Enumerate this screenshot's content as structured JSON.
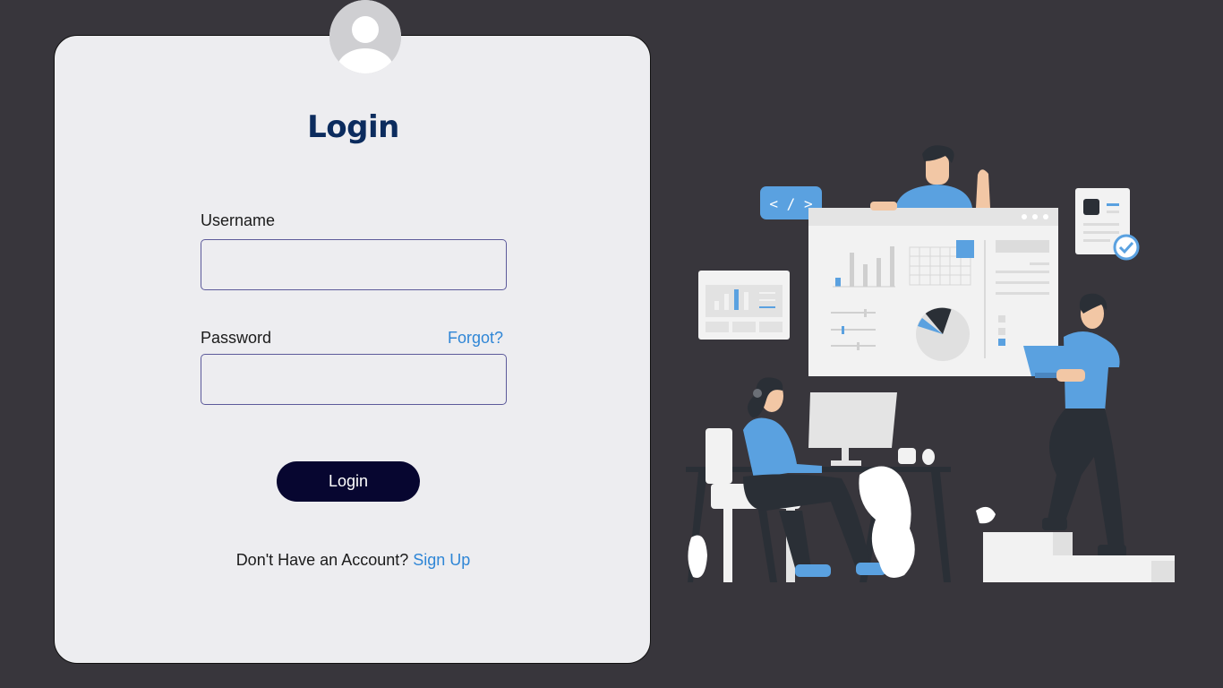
{
  "login_form": {
    "title": "Login",
    "username_label": "Username",
    "username_value": "",
    "password_label": "Password",
    "password_value": "",
    "forgot_link": "Forgot?",
    "submit_label": "Login",
    "signup_prompt": "Don't Have an Account?",
    "signup_link": "Sign Up"
  },
  "illustration": {
    "code_tag": "< / >"
  },
  "colors": {
    "page_background": "#38363c",
    "card_background": "#ededf0",
    "title": "#0c2c5e",
    "link": "#2f86d6",
    "button": "#070630",
    "accent_blue": "#5aa1e0"
  }
}
